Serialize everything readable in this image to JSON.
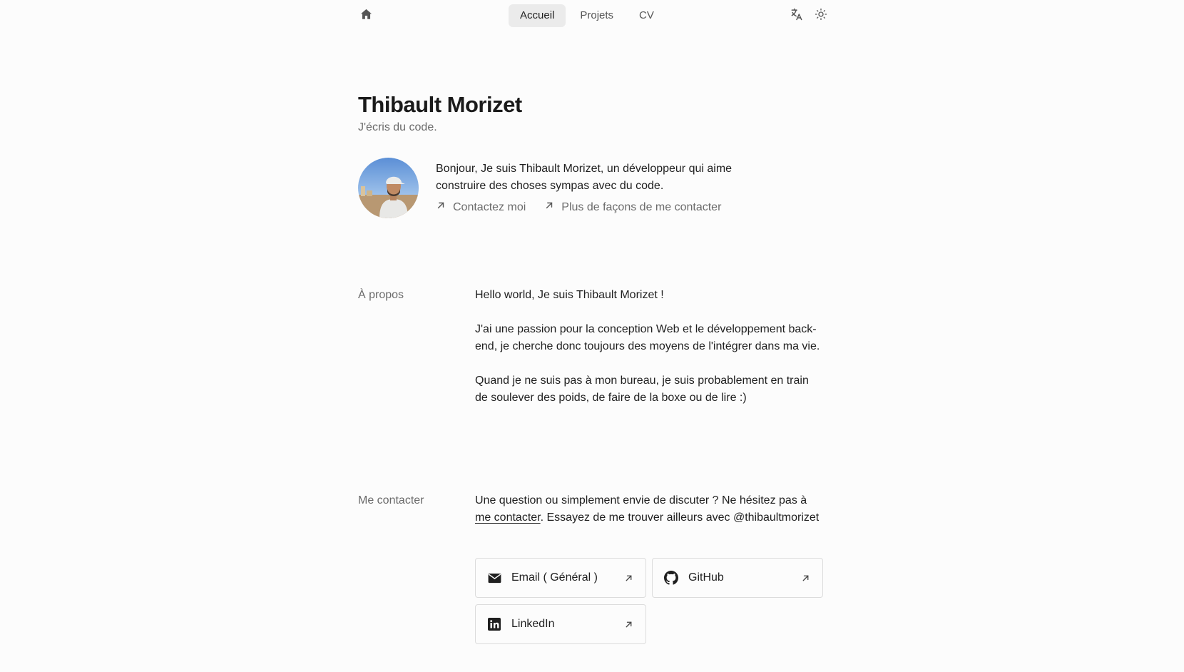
{
  "colors": {
    "background": "#fcfcfc",
    "text": "#1f1f1f",
    "muted": "#6b6b6b",
    "nav_active_bg": "#ebebeb",
    "card_border": "#dcdcdc"
  },
  "header": {
    "home_icon": "home-icon",
    "nav": [
      {
        "label": "Accueil",
        "active": true
      },
      {
        "label": "Projets",
        "active": false
      },
      {
        "label": "CV",
        "active": false
      }
    ],
    "icons": [
      "translate-icon",
      "sun-icon"
    ]
  },
  "hero": {
    "name": "Thibault Morizet",
    "tagline": "J'écris du code."
  },
  "intro": {
    "text": "Bonjour, Je suis Thibault Morizet, un développeur qui aime construire des choses sympas avec du code.",
    "links": [
      {
        "label": "Contactez moi",
        "icon": "arrow-up-right-icon"
      },
      {
        "label": "Plus de façons de me contacter",
        "icon": "arrow-up-right-icon"
      }
    ]
  },
  "about": {
    "label": "À propos",
    "paragraphs": [
      "Hello world, Je suis Thibault Morizet !",
      "J'ai une passion pour la conception Web et le développement back-end, je cherche donc toujours des moyens de l'intégrer dans ma vie.",
      "Quand je ne suis pas à mon bureau, je suis probablement en train de soulever des poids, de faire de la boxe ou de lire :)"
    ]
  },
  "contact": {
    "label": "Me contacter",
    "text_before": "Une question ou simplement envie de discuter ? Ne hésitez pas à ",
    "link_text": "me contacter",
    "text_after": ". Essayez de me trouver ailleurs avec @thibaultmorizet",
    "cards": [
      {
        "label": "Email ( Général )",
        "icon": "mail-icon"
      },
      {
        "label": "GitHub",
        "icon": "github-icon"
      },
      {
        "label": "LinkedIn",
        "icon": "linkedin-icon"
      }
    ]
  }
}
